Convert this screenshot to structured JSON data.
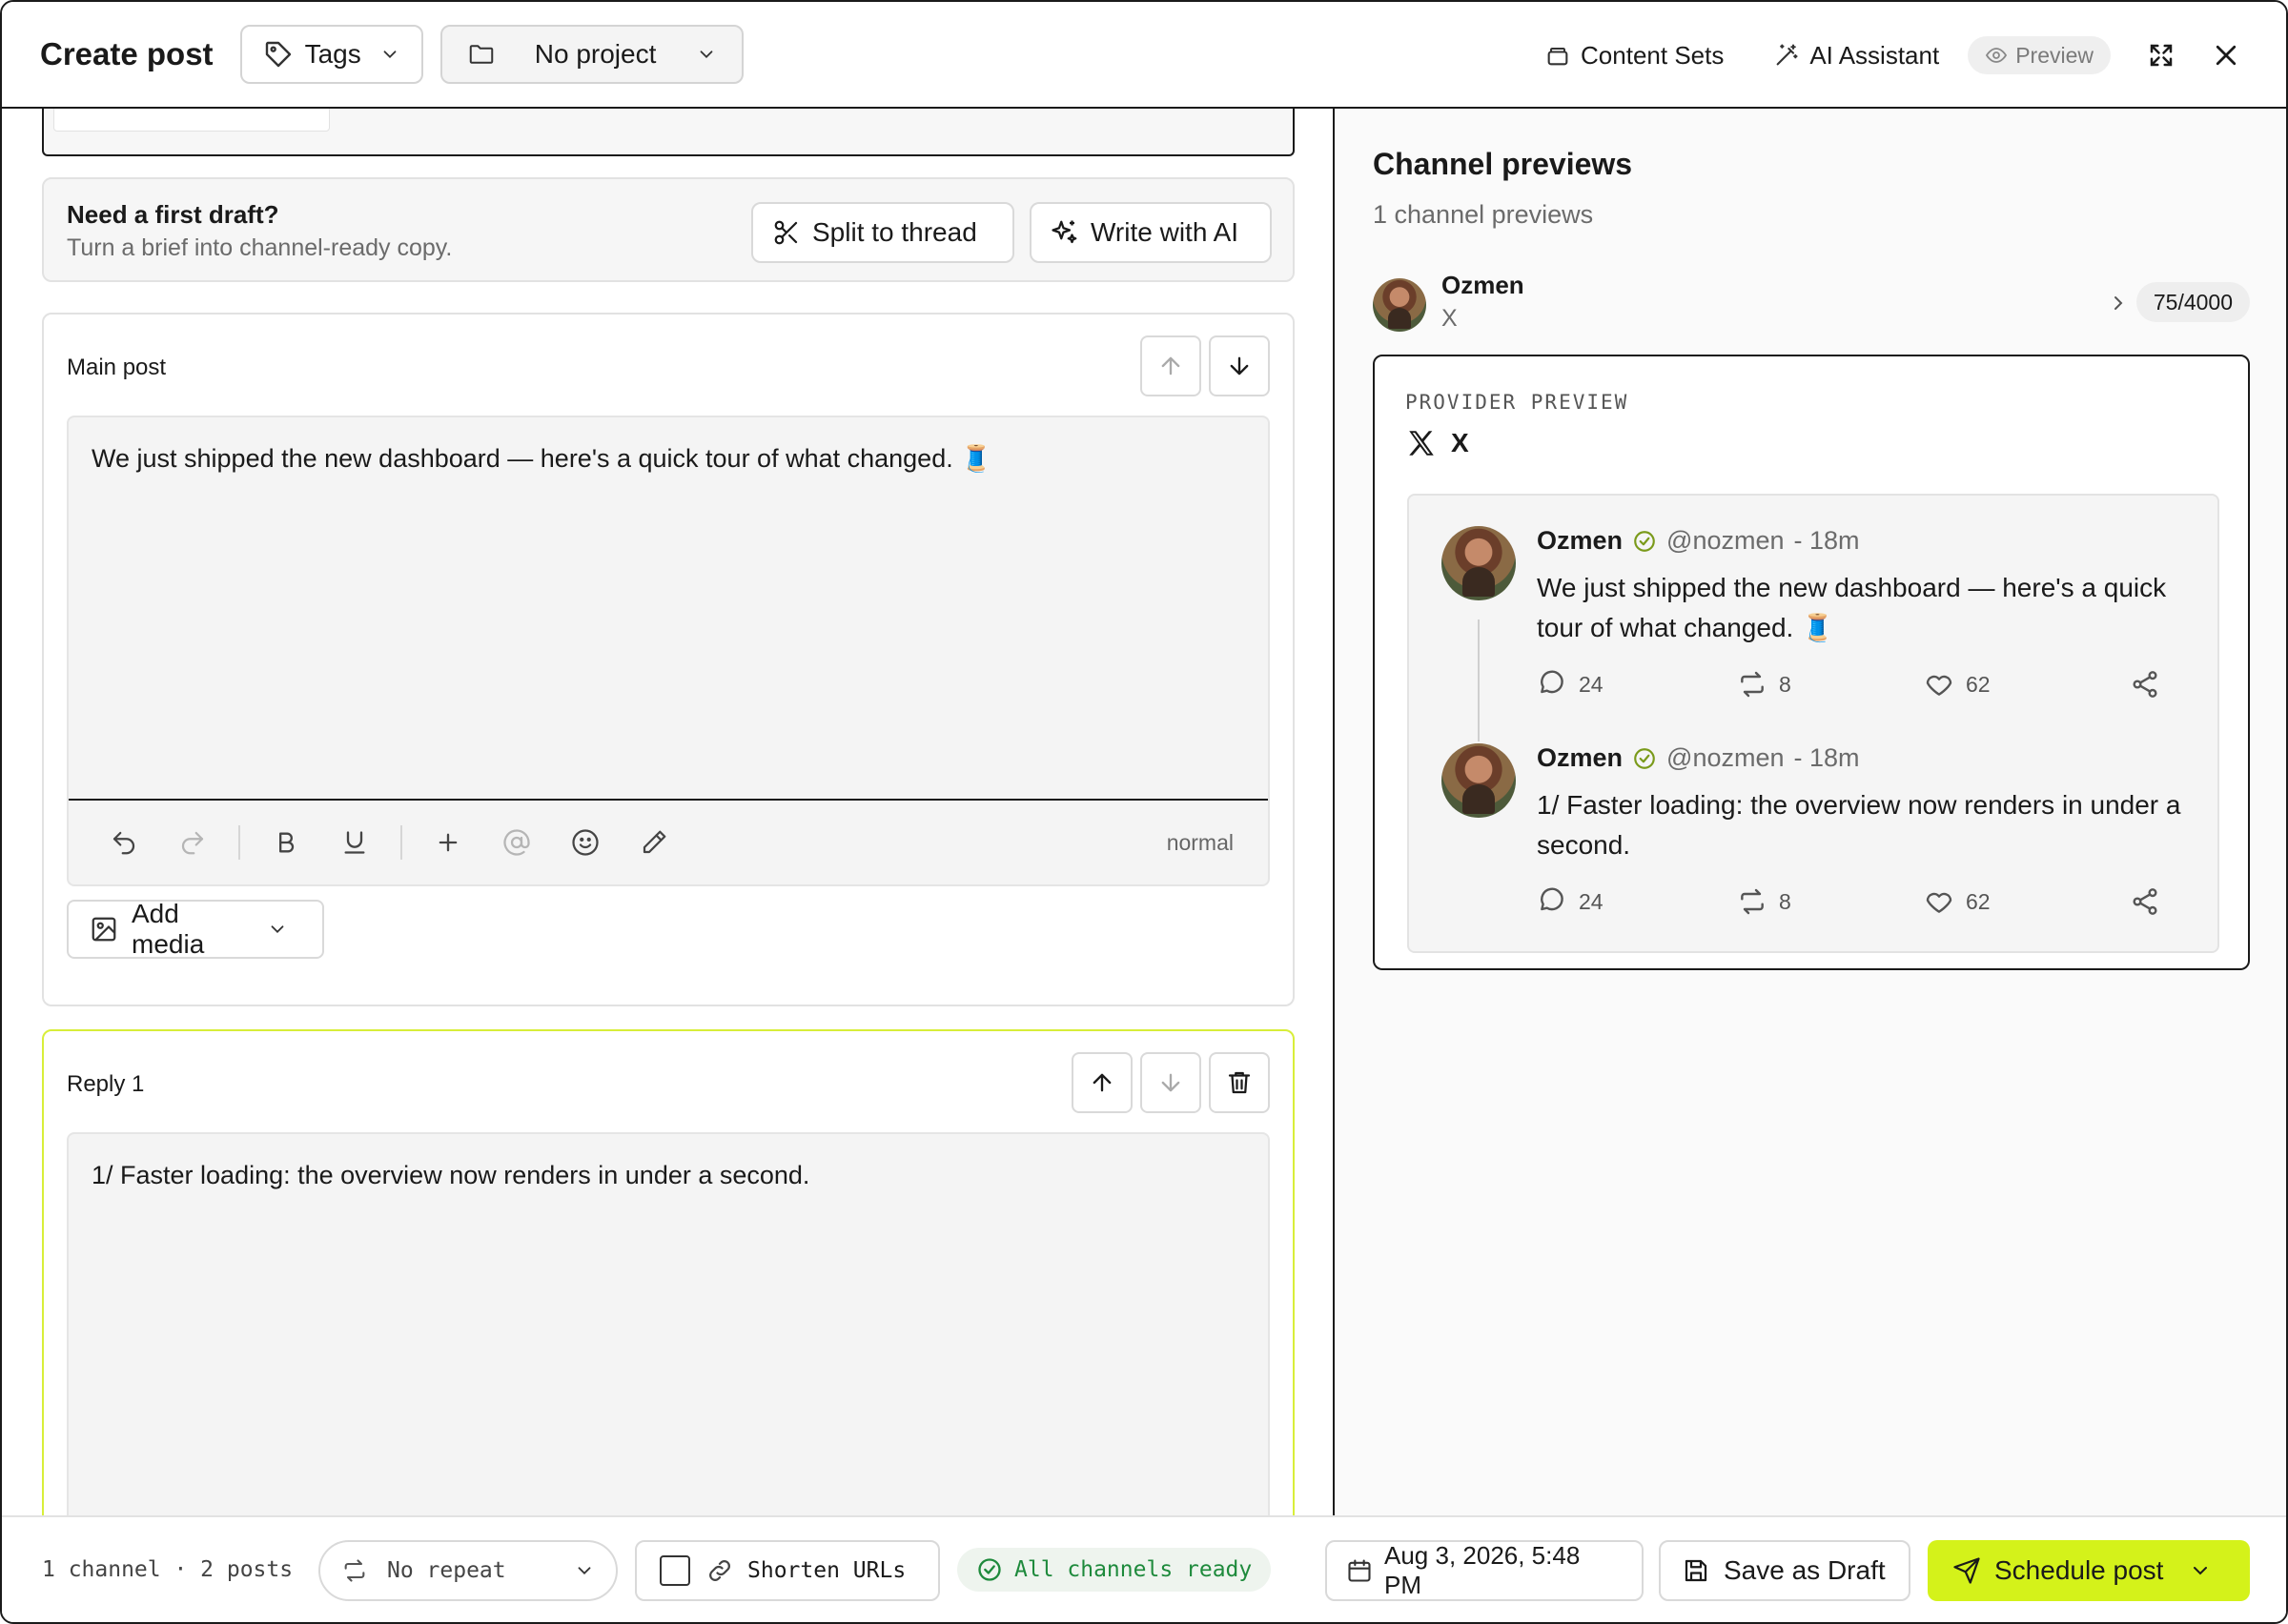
{
  "header": {
    "title": "Create post",
    "tags_label": "Tags",
    "project_label": "No project",
    "content_sets_label": "Content Sets",
    "ai_assistant_label": "AI Assistant",
    "preview_label": "Preview"
  },
  "draft_helper": {
    "title": "Need a first draft?",
    "subtitle": "Turn a brief into channel-ready copy.",
    "split_label": "Split to thread",
    "write_ai_label": "Write with AI"
  },
  "posts": [
    {
      "label": "Main post",
      "text": "We just shipped the new dashboard — here's a quick tour of what changed. 🧵",
      "text_mode": "normal",
      "add_media_label": "Add media"
    },
    {
      "label": "Reply 1",
      "text": "1/ Faster loading: the overview now renders in under a second."
    }
  ],
  "channel_previews": {
    "title": "Channel previews",
    "subtitle": "1 channel previews",
    "channel": {
      "name": "Ozmen",
      "network": "X",
      "counter": "75/4000"
    },
    "provider_label": "PROVIDER PREVIEW",
    "provider_name": "X",
    "tweets": [
      {
        "name": "Ozmen",
        "handle": "@nozmen",
        "time": "- 18m",
        "text": "We just shipped the new dashboard — here's a quick tour of what changed. 🧵",
        "replies": "24",
        "reposts": "8",
        "likes": "62"
      },
      {
        "name": "Ozmen",
        "handle": "@nozmen",
        "time": "- 18m",
        "text": "1/ Faster loading: the overview now renders in under a second.",
        "replies": "24",
        "reposts": "8",
        "likes": "62"
      }
    ]
  },
  "footer": {
    "summary": "1 channel · 2 posts",
    "repeat_label": "No repeat",
    "shorten_label": "Shorten URLs",
    "ready_label": "All channels ready",
    "date_label": "Aug 3, 2026, 5:48 PM",
    "save_draft_label": "Save as Draft",
    "schedule_label": "Schedule post"
  },
  "colors": {
    "accent": "#d4f21a",
    "ready_green": "#1e8a3c",
    "verified_green": "#7a9a1a"
  }
}
